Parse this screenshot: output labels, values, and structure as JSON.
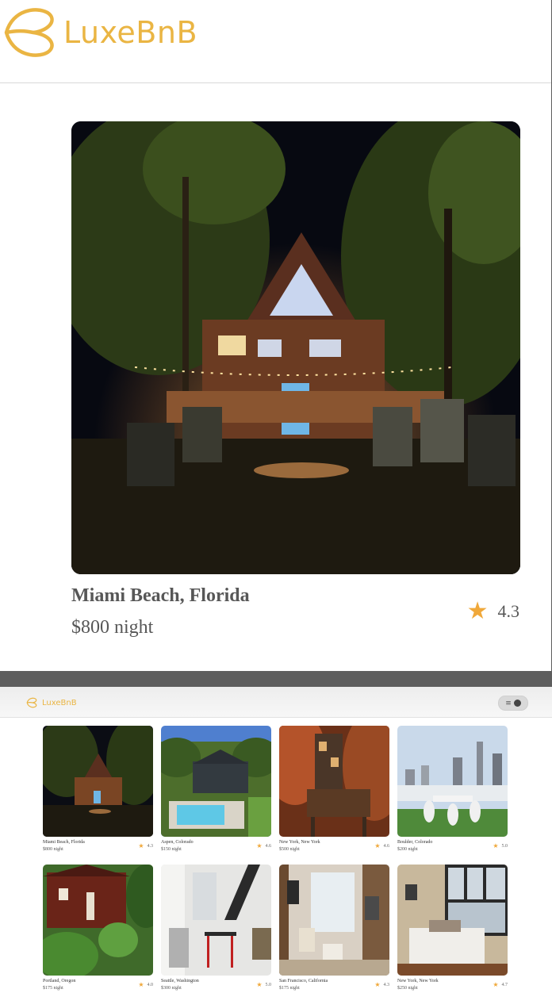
{
  "zoom_view": {
    "brand": "LuxeBnB",
    "listing": {
      "title": "Miami Beach, Florida",
      "price": "$800 night",
      "rating": "4.3"
    }
  },
  "page": {
    "brand": "LuxeBnB",
    "menu_icon": "hamburger-menu-icon",
    "listings": [
      {
        "location": "Miami Beach, Florida",
        "price": "$800 night",
        "rating": "4.3"
      },
      {
        "location": "Aspen, Colorado",
        "price": "$150 night",
        "rating": "4.6"
      },
      {
        "location": "New York, New York",
        "price": "$500 night",
        "rating": "4.6"
      },
      {
        "location": "Boulder, Colorado",
        "price": "$200 night",
        "rating": "5.0"
      },
      {
        "location": "Portland, Oregon",
        "price": "$175 night",
        "rating": "4.0"
      },
      {
        "location": "Seattle, Washington",
        "price": "$300 night",
        "rating": "5.0"
      },
      {
        "location": "San Francisco, California",
        "price": "$175 night",
        "rating": "4.3"
      },
      {
        "location": "New York, New York",
        "price": "$250 night",
        "rating": "4.7"
      }
    ]
  },
  "colors": {
    "brand": "#eab543",
    "star": "#f0a83a",
    "text": "#575757"
  }
}
